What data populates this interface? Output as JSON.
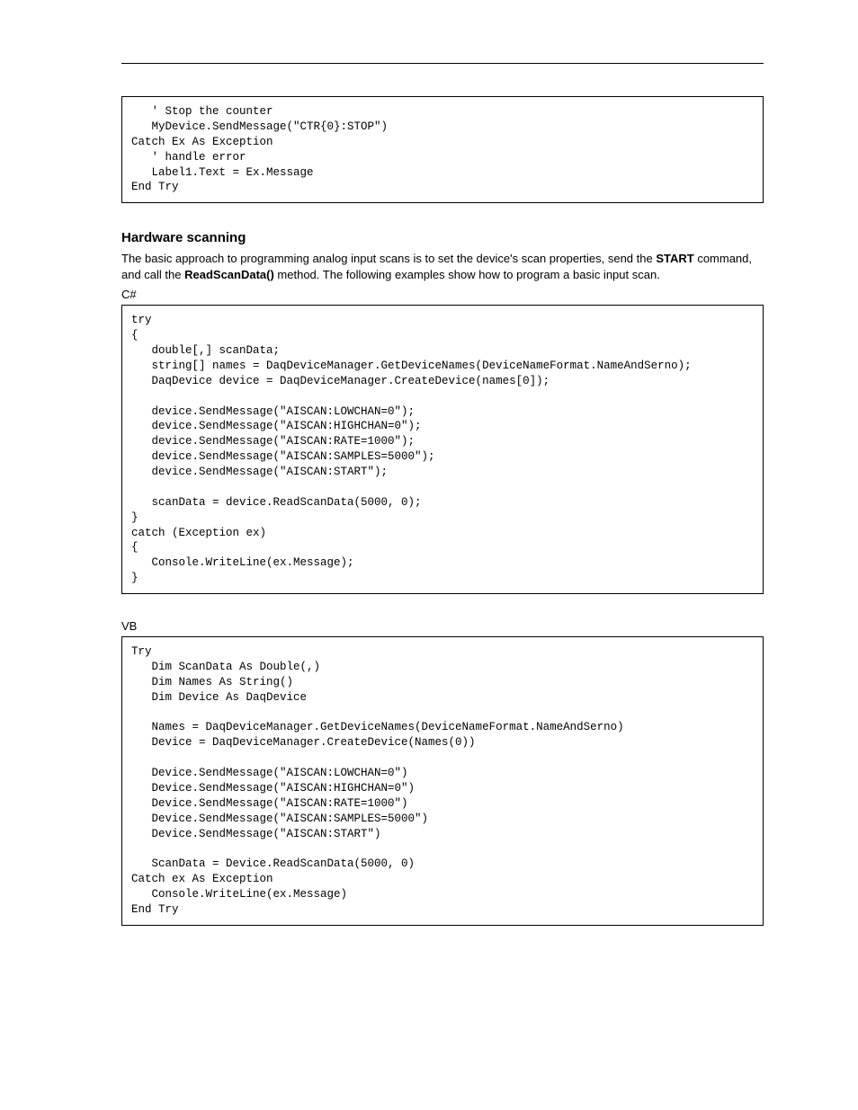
{
  "codeBlock1": "   ' Stop the counter\n   MyDevice.SendMessage(\"CTR{0}:STOP\")\nCatch Ex As Exception\n   ' handle error\n   Label1.Text = Ex.Message\nEnd Try",
  "section": {
    "heading": "Hardware scanning",
    "paragraph_pre": "The basic approach to programming analog input scans is to set the device's scan properties, send the ",
    "paragraph_bold1": "START",
    "paragraph_mid": " command, and call the ",
    "paragraph_bold2": "ReadScanData()",
    "paragraph_post": " method. The following examples show how to program a basic input scan."
  },
  "langLabel1": "C#",
  "codeBlock2": "try\n{\n   double[,] scanData;\n   string[] names = DaqDeviceManager.GetDeviceNames(DeviceNameFormat.NameAndSerno);\n   DaqDevice device = DaqDeviceManager.CreateDevice(names[0]);\n\n   device.SendMessage(\"AISCAN:LOWCHAN=0\");\n   device.SendMessage(\"AISCAN:HIGHCHAN=0\");\n   device.SendMessage(\"AISCAN:RATE=1000\");\n   device.SendMessage(\"AISCAN:SAMPLES=5000\");\n   device.SendMessage(\"AISCAN:START\");\n\n   scanData = device.ReadScanData(5000, 0);\n}\ncatch (Exception ex)\n{\n   Console.WriteLine(ex.Message);\n}",
  "langLabel2": "VB",
  "codeBlock3": "Try\n   Dim ScanData As Double(,)\n   Dim Names As String()\n   Dim Device As DaqDevice\n\n   Names = DaqDeviceManager.GetDeviceNames(DeviceNameFormat.NameAndSerno)\n   Device = DaqDeviceManager.CreateDevice(Names(0))\n\n   Device.SendMessage(\"AISCAN:LOWCHAN=0\")\n   Device.SendMessage(\"AISCAN:HIGHCHAN=0\")\n   Device.SendMessage(\"AISCAN:RATE=1000\")\n   Device.SendMessage(\"AISCAN:SAMPLES=5000\")\n   Device.SendMessage(\"AISCAN:START\")\n\n   ScanData = Device.ReadScanData(5000, 0)\nCatch ex As Exception\n   Console.WriteLine(ex.Message)\nEnd Try"
}
